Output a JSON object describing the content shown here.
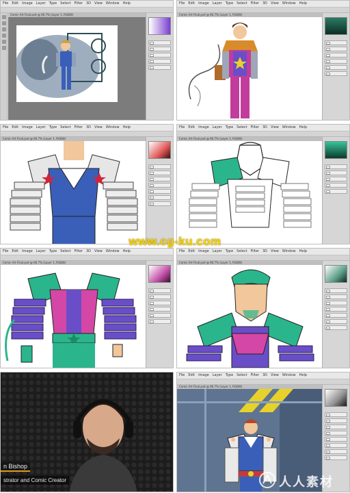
{
  "app": {
    "menu_items": [
      "File",
      "Edit",
      "Image",
      "Layer",
      "Type",
      "Select",
      "Filter",
      "3D",
      "View",
      "Window",
      "Help"
    ],
    "doc_tab_text": "Comic Art Final.psd @ 66.7% (Layer 1, RGB/8)"
  },
  "panels": [
    {
      "id": "p1",
      "subject": "full-figure-background"
    },
    {
      "id": "p2",
      "subject": "full-figure-color"
    },
    {
      "id": "p3",
      "subject": "torso-flats-blue"
    },
    {
      "id": "p4",
      "subject": "lineart-closeup"
    },
    {
      "id": "p5",
      "subject": "torso-flats-purple"
    },
    {
      "id": "p6",
      "subject": "head-flats-purple"
    },
    {
      "id": "p7",
      "subject": "instructor-video"
    },
    {
      "id": "p8",
      "subject": "final-render"
    }
  ],
  "colors": {
    "ui_gray": "#d4d4d4",
    "purple": "#6a4ec8",
    "magenta": "#d447a6",
    "teal": "#2bb58c",
    "blue": "#3a5fb8",
    "yellow": "#e8d22a",
    "skin": "#f1c79b",
    "orange_accent": "#e49a16"
  },
  "watermark": {
    "text": "www.cg-ku.com"
  },
  "video": {
    "name_partial": "n Bishop",
    "title_partial": "strator and Comic Creator"
  },
  "logo": {
    "text": "人人素材"
  }
}
